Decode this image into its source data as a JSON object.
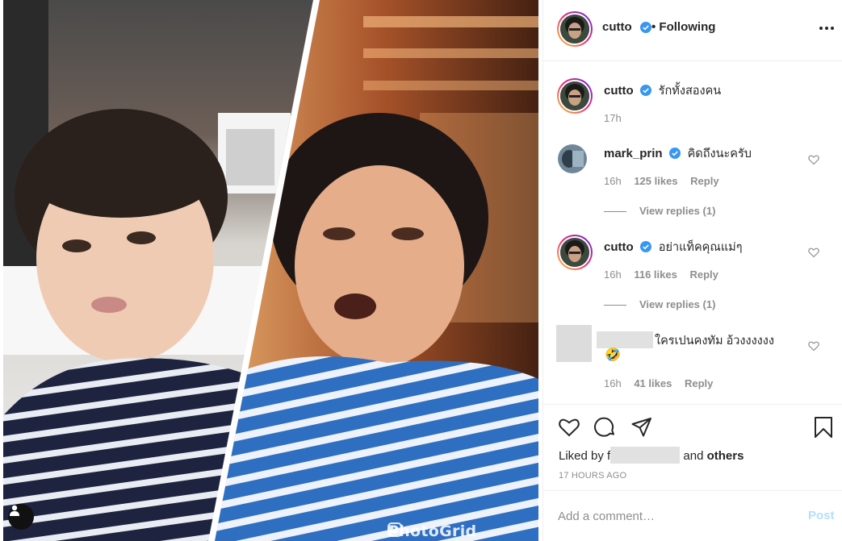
{
  "post": {
    "watermark": "PhotoGrid",
    "image_description_icons": [
      "user-tag-icon"
    ]
  },
  "header": {
    "username": "cutto",
    "follow_status": "• Following"
  },
  "caption": {
    "username": "cutto",
    "text": "รักทั้งสองคน",
    "time": "17h"
  },
  "comments": [
    {
      "username": "mark_prin",
      "verified": true,
      "text": "คิดถึงนะครับ",
      "time": "16h",
      "likes": "125 likes",
      "reply": "Reply",
      "view_replies": "View replies (1)"
    },
    {
      "username": "cutto",
      "verified": true,
      "text": "อย่าแท็คคุณแม่ๆ",
      "time": "16h",
      "likes": "116 likes",
      "reply": "Reply",
      "view_replies": "View replies (1)"
    },
    {
      "username": "",
      "verified": false,
      "text": "ใครเปนคงทัม อ้วงงงงงง",
      "emoji": "🤣",
      "time": "16h",
      "likes": "41 likes",
      "reply": "Reply"
    }
  ],
  "actions": {
    "liked_by_prefix": "Liked by",
    "liked_by_partial": "f",
    "liked_by_suffix": "and",
    "others": "others",
    "time_ago": "17 HOURS AGO"
  },
  "comment_box": {
    "placeholder": "Add a comment…",
    "post_label": "Post"
  },
  "colors": {
    "verified_blue": "#3897f0",
    "post_disabled": "#b2dffc",
    "meta_gray": "#8e8e8e"
  }
}
